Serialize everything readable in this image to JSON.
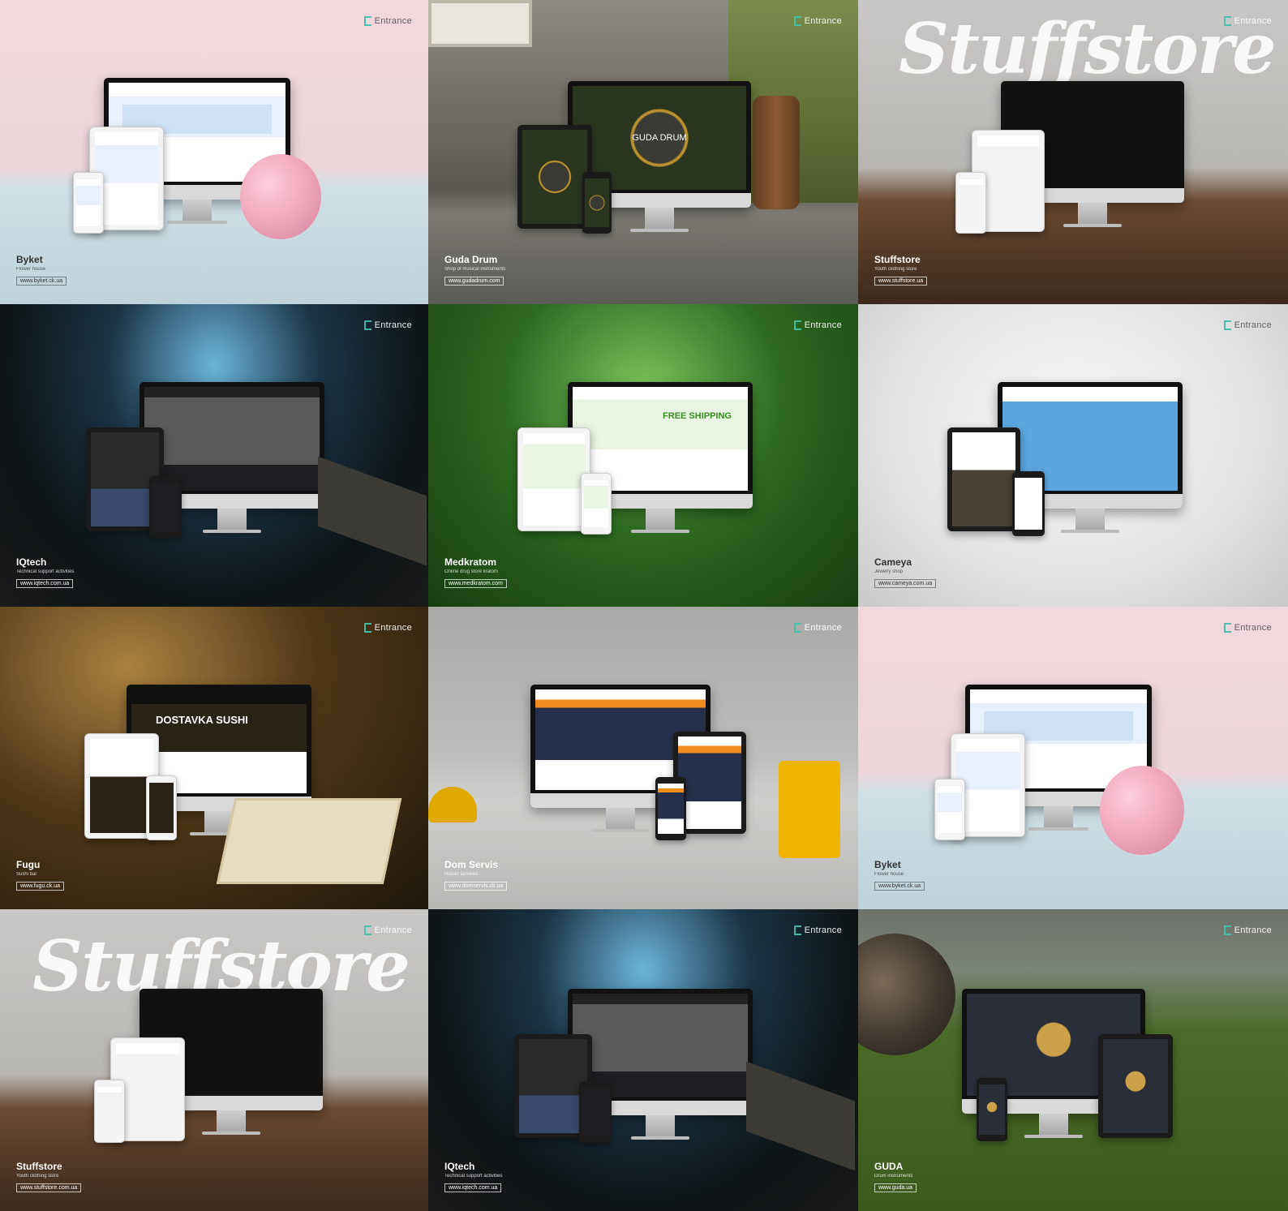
{
  "brand_label": "Entrance",
  "tiles": [
    {
      "name": "Byket",
      "sub": "Flower house",
      "url": "www.byket.ck.ua"
    },
    {
      "name": "Guda Drum",
      "sub": "Shop of musical instruments",
      "url": "www.gudadrum.com"
    },
    {
      "name": "Stuffstore",
      "sub": "Youth clothing store",
      "url": "www.stuffstore.ua"
    },
    {
      "name": "IQtech",
      "sub": "Technical support activities",
      "url": "www.iqtech.com.ua"
    },
    {
      "name": "Medkratom",
      "sub": "Online drug store kratom",
      "url": "www.medkratom.com"
    },
    {
      "name": "Cameya",
      "sub": "Jewelry shop",
      "url": "www.cameya.com.ua"
    },
    {
      "name": "Fugu",
      "sub": "Sushi bar",
      "url": "www.fugu.ck.ua"
    },
    {
      "name": "Dom Servis",
      "sub": "Repair services",
      "url": "www.domservis.ck.ua"
    },
    {
      "name": "Byket",
      "sub": "Flower house",
      "url": "www.byket.ck.ua"
    },
    {
      "name": "Stuffstore",
      "sub": "Youth clothing store",
      "url": "www.stuffstore.com.ua"
    },
    {
      "name": "IQtech",
      "sub": "Technical support activities",
      "url": "www.iqtech.com.ua"
    },
    {
      "name": "GUDA",
      "sub": "Drum instruments",
      "url": "www.guda.ua"
    }
  ],
  "overlays": {
    "stuff_logo": "Stuffstore",
    "guda_screen_title": "GUDA DRUM",
    "free_shipping": "FREE SHIPPING",
    "fugu_promo": "DOSTAVKA SUSHI"
  }
}
